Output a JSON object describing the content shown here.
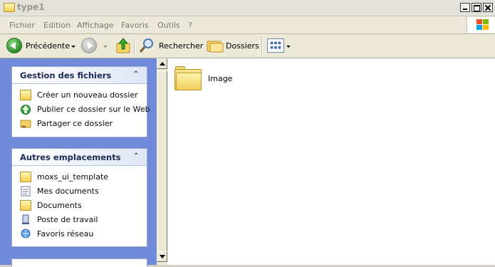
{
  "window": {
    "title": "type1"
  },
  "menu": {
    "items": [
      "Fichier",
      "Edition",
      "Affichage",
      "Favoris",
      "Outils",
      "?"
    ]
  },
  "toolbar": {
    "back_label": "Précédente",
    "search_label": "Rechercher",
    "folders_label": "Dossiers"
  },
  "tasks_panel": {
    "title": "Gestion des fichiers",
    "items": [
      {
        "label": "Créer un nouveau dossier",
        "icon": "new-folder-icon"
      },
      {
        "label": "Publier ce dossier sur le Web",
        "icon": "publish-web-icon"
      },
      {
        "label": "Partager ce dossier",
        "icon": "share-folder-icon"
      }
    ]
  },
  "places_panel": {
    "title": "Autres emplacements",
    "items": [
      {
        "label": "moxs_ui_template",
        "icon": "folder-icon"
      },
      {
        "label": "Mes documents",
        "icon": "my-documents-icon"
      },
      {
        "label": "Documents",
        "icon": "folder-icon"
      },
      {
        "label": "Poste de travail",
        "icon": "my-computer-icon"
      },
      {
        "label": "Favoris réseau",
        "icon": "network-places-icon"
      }
    ]
  },
  "files": [
    {
      "name": "Image",
      "icon": "folder-icon"
    }
  ],
  "colors": {
    "task_pane": "#6f8ad9",
    "panel_title": "#1b2a55",
    "toolbar": "#ece9d8"
  }
}
